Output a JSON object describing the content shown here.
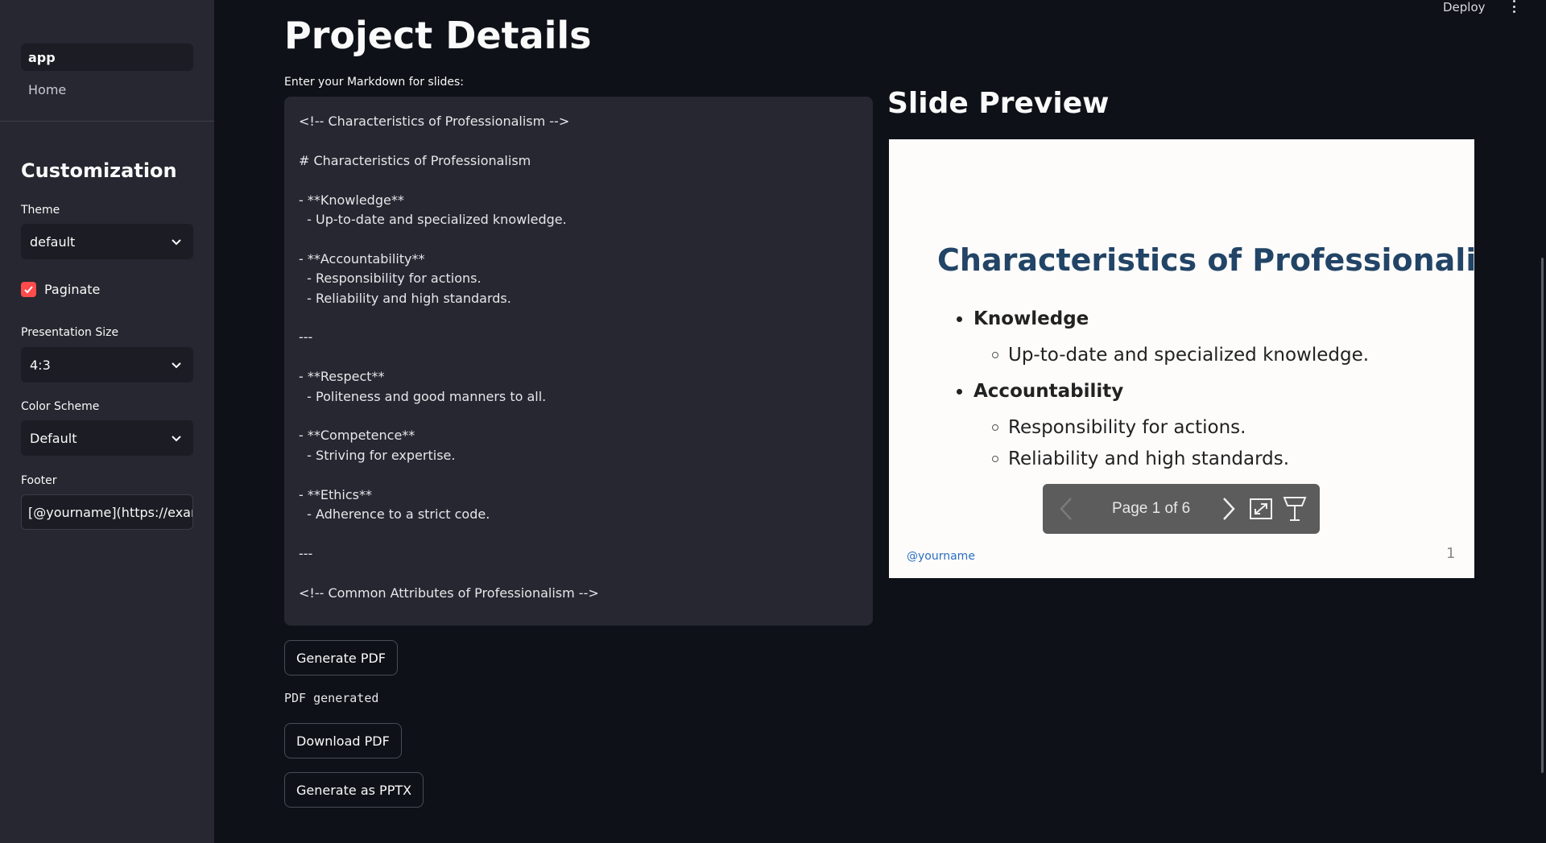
{
  "sidebar": {
    "nav": [
      {
        "label": "app"
      },
      {
        "label": "Home"
      }
    ],
    "heading": "Customization",
    "theme": {
      "label": "Theme",
      "value": "default"
    },
    "paginate": {
      "label": "Paginate",
      "checked": true
    },
    "size": {
      "label": "Presentation Size",
      "value": "4:3"
    },
    "color_scheme": {
      "label": "Color Scheme",
      "value": "Default"
    },
    "footer": {
      "label": "Footer",
      "value": "[@yourname](https://example.com)"
    }
  },
  "header": {
    "deploy_label": "Deploy"
  },
  "main": {
    "title": "Project Details",
    "markdown_label": "Enter your Markdown for slides:",
    "markdown_lines": [
      "<!-- Characteristics of Professionalism -->",
      "",
      "# Characteristics of Professionalism",
      "",
      "- **Knowledge**",
      "  - Up-to-date and specialized knowledge.",
      "",
      "- **Accountability**",
      "  - Responsibility for actions.",
      "  - Reliability and high standards.",
      "",
      "---",
      "",
      "- **Respect**",
      "  - Politeness and good manners to all.",
      "",
      "- **Competence**",
      "  - Striving for expertise.",
      "",
      "- **Ethics**",
      "  - Adherence to a strict code.",
      "",
      "---",
      "",
      "<!-- Common Attributes of Professionalism -->"
    ],
    "generate_pdf_label": "Generate PDF",
    "status": "PDF generated",
    "download_pdf_label": "Download PDF",
    "generate_pptx_label": "Generate as PPTX"
  },
  "preview": {
    "title": "Slide Preview",
    "slide": {
      "title": "Characteristics of Professionalism",
      "bullets": [
        {
          "text": "Knowledge",
          "level": 1
        },
        {
          "text": "Up-to-date and specialized knowledge.",
          "level": 2
        },
        {
          "text": "Accountability",
          "level": 1
        },
        {
          "text": "Responsibility for actions.",
          "level": 2
        },
        {
          "text": "Reliability and high standards.",
          "level": 2
        }
      ],
      "footer": "@yourname",
      "number": "1"
    },
    "pager": {
      "text": "Page 1 of 6",
      "prev_icon": "chevron-left-icon",
      "next_icon": "chevron-right-icon",
      "fullscreen_icon": "fullscreen-icon",
      "presenter_icon": "presenter-icon"
    }
  },
  "colors": {
    "background": "#0e1117",
    "sidebar": "#262730",
    "accent": "#ff4b4b",
    "slide_title": "#224466",
    "footer_link": "#2a6fc0"
  }
}
